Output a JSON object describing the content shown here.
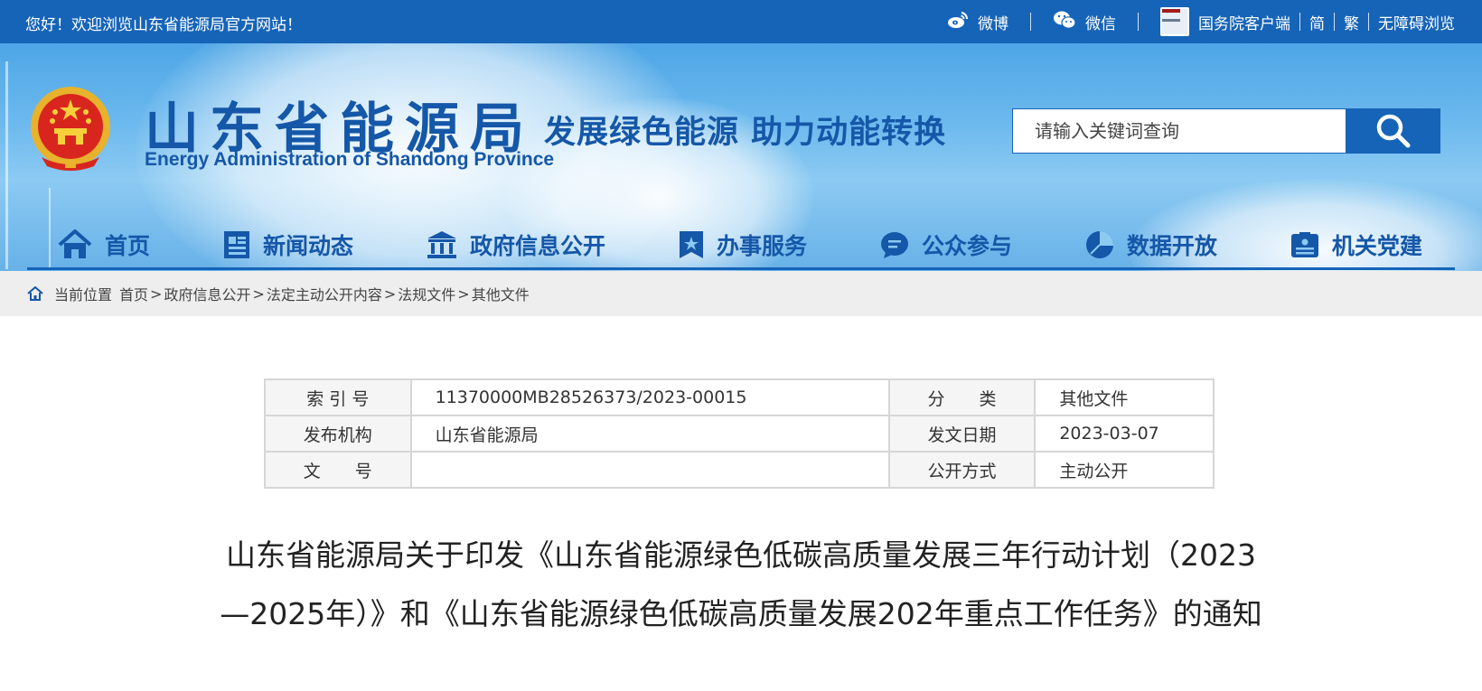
{
  "topbar": {
    "welcome": "您好！欢迎浏览山东省能源局官方网站！",
    "weibo": "微博",
    "wechat": "微信",
    "gov_app": "国务院客户端",
    "simplified": "简",
    "traditional": "繁",
    "accessibility": "无障碍浏览"
  },
  "header": {
    "title_cn": "山东省能源局",
    "title_en": "Energy Administration of Shandong Province",
    "slogan": "发展绿色能源  助力动能转换",
    "search_placeholder": "请输入关键词查询"
  },
  "nav": [
    {
      "label": "首页",
      "icon": "home-icon"
    },
    {
      "label": "新闻动态",
      "icon": "news-icon"
    },
    {
      "label": "政府信息公开",
      "icon": "government-icon"
    },
    {
      "label": "办事服务",
      "icon": "service-icon"
    },
    {
      "label": "公众参与",
      "icon": "chat-icon"
    },
    {
      "label": "数据开放",
      "icon": "pie-chart-icon"
    },
    {
      "label": "机关党建",
      "icon": "id-card-icon"
    }
  ],
  "breadcrumb": {
    "prefix": "当前位置",
    "items": [
      "首页",
      "政府信息公开",
      "法定主动公开内容",
      "法规文件",
      "其他文件"
    ],
    "separator": ">"
  },
  "info_table": {
    "rows": [
      {
        "label1": "索 引 号",
        "value1": "11370000MB28526373/2023-00015",
        "label2": "分　　类",
        "value2": "其他文件"
      },
      {
        "label1": "发布机构",
        "value1": "山东省能源局",
        "label2": "发文日期",
        "value2": "2023-03-07"
      },
      {
        "label1": "文　　号",
        "value1": "",
        "label2": "公开方式",
        "value2": "主动公开"
      }
    ]
  },
  "article": {
    "title": "山东省能源局关于印发《山东省能源绿色低碳高质量发展三年行动计划（2023—2025年）》和《山东省能源绿色低碳高质量发展202年重点工作任务》的通知"
  },
  "colors": {
    "primary": "#1664b8",
    "brand_text": "#1557a8",
    "crumb_bg": "#eeeeee"
  }
}
